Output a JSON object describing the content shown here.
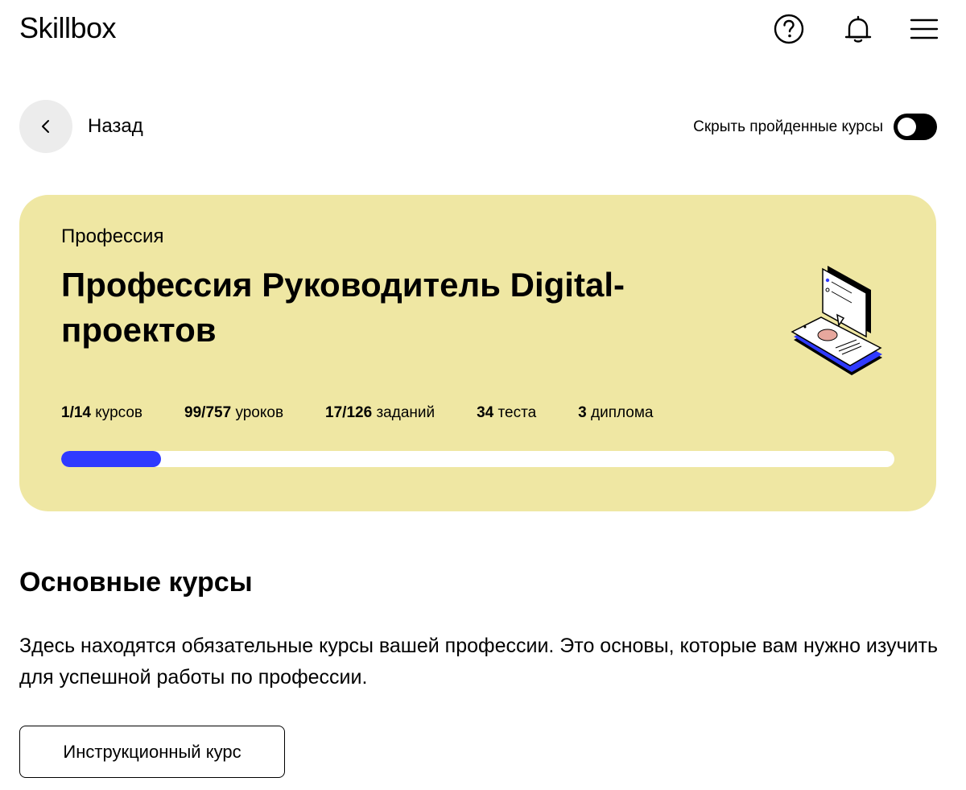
{
  "header": {
    "logo": "Skillbox",
    "icons": [
      "help-icon",
      "bell-icon",
      "menu-icon"
    ]
  },
  "nav": {
    "back_label": "Назад",
    "hide_completed_label": "Скрыть пройденные курсы",
    "hide_completed_on": true
  },
  "profession": {
    "kicker": "Профессия",
    "title": "Профессия Руководитель Digital-проектов",
    "stats": {
      "courses_num": "1/14",
      "courses_label": "курсов",
      "lessons_num": "99/757",
      "lessons_label": "уроков",
      "tasks_num": "17/126",
      "tasks_label": "заданий",
      "tests_num": "34",
      "tests_label": "теста",
      "diplomas_num": "3",
      "diplomas_label": "диплома"
    },
    "progress_percent": 12,
    "colors": {
      "card": "#efe7a3",
      "progress": "#2f3aff"
    }
  },
  "section": {
    "title": "Основные курсы",
    "description": "Здесь находятся обязательные курсы вашей профессии. Это основы, которые вам нужно изучить для успешной работы по профессии.",
    "course_button_label": "Инструкционный курс"
  }
}
